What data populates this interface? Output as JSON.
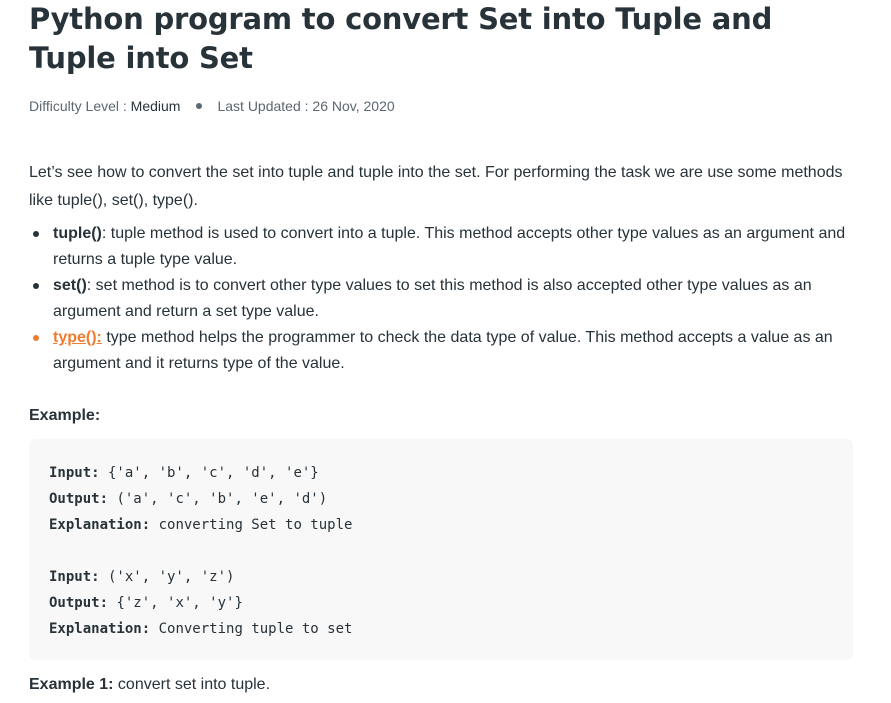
{
  "article": {
    "title": "Python program to convert Set into Tuple and Tuple into Set",
    "meta": {
      "difficulty_label": "Difficulty Level : ",
      "difficulty_value": "Medium",
      "updated_label": "Last Updated : ",
      "updated_value": "26 Nov, 2020"
    },
    "intro": "Let’s see how to convert the set into tuple and tuple into the set. For performing the task we are use some methods like tuple(), set(), type().",
    "methods": [
      {
        "name": "tuple()",
        "text": ": tuple method is used to convert into a tuple. This method accepts other type values as an argument and returns a tuple type value."
      },
      {
        "name": "set()",
        "text": ": set method is to convert other type values to set this method is also accepted other type values as an argument and return a set type value."
      },
      {
        "name": "type():",
        "text": " type method helps the programmer to check the data type of value. This method accepts a value as an argument and it returns type of the value."
      }
    ],
    "example_heading": "Example:",
    "code": {
      "block1": {
        "input_label": "Input:",
        "input_value": " {'a', 'b', 'c', 'd', 'e'}",
        "output_label": "Output:",
        "output_value": " ('a', 'c', 'b', 'e', 'd')",
        "explanation_label": "Explanation:",
        "explanation_value": " converting Set to tuple"
      },
      "block2": {
        "input_label": "Input:",
        "input_value": " ('x', 'y', 'z')",
        "output_label": "Output:",
        "output_value": " {'z', 'x', 'y'}",
        "explanation_label": "Explanation:",
        "explanation_value": " Converting tuple to set"
      }
    },
    "example1": {
      "label": "Example 1:",
      "text": " convert set into tuple."
    }
  },
  "colors": {
    "text": "#273239",
    "muted": "#5c6770",
    "link": "#ef7c30",
    "code_bg": "#f8f8f8"
  }
}
